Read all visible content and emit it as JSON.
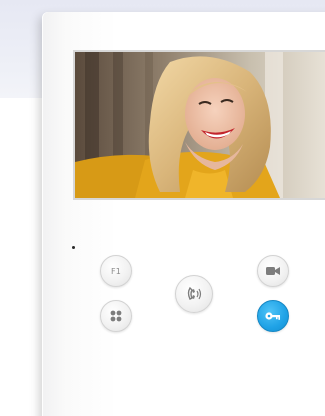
{
  "device": {
    "f1_button": {
      "label": "F1",
      "icon": "f1-function-icon"
    },
    "menu_button": {
      "icon": "grid-menu-icon"
    },
    "talk_button": {
      "icon": "handset-talk-icon"
    },
    "video_button": {
      "icon": "video-camera-icon"
    },
    "unlock_button": {
      "icon": "key-unlock-icon",
      "accent": "#1fa2e6"
    }
  },
  "colors": {
    "background_band": "#e9ebf4",
    "panel": "#ffffff",
    "accent_blue": "#1fa2e6",
    "button_gray": "#f0f0f0"
  }
}
